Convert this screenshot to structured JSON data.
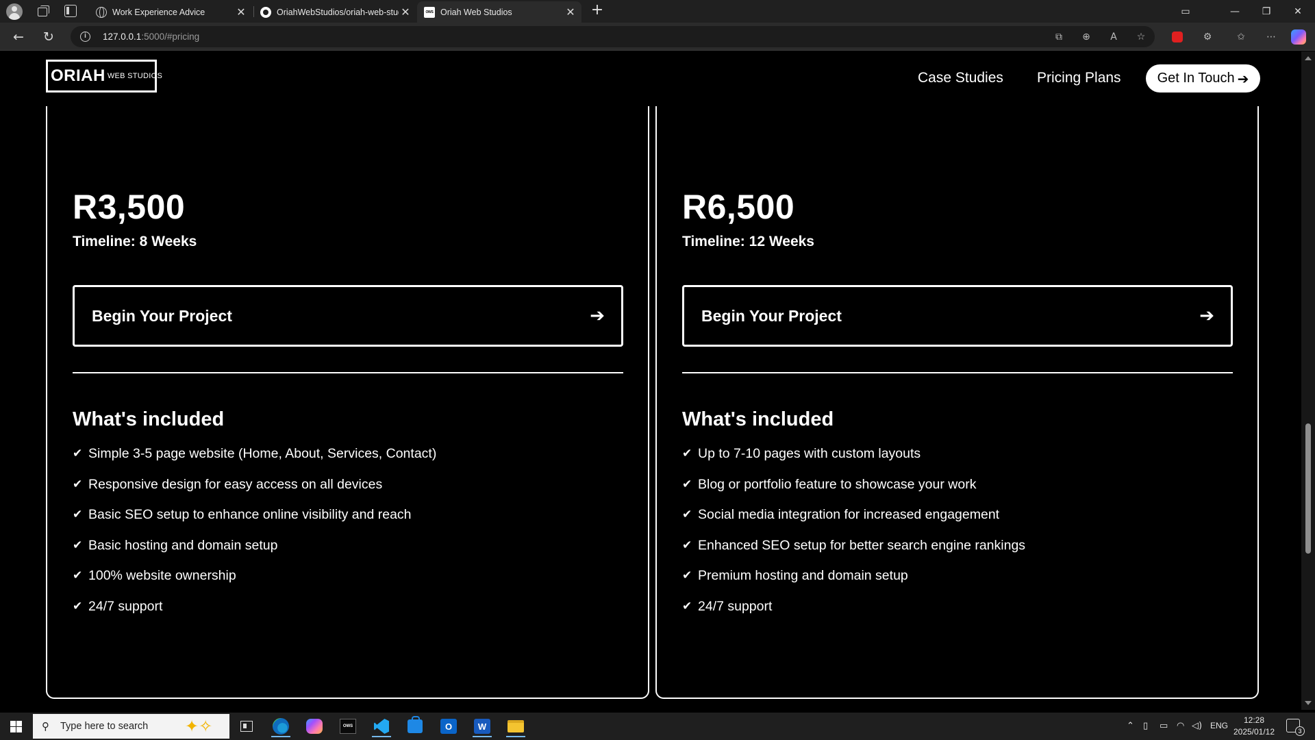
{
  "browser": {
    "tabs": [
      {
        "title": "Work Experience Advice",
        "favicon": "globe-icon",
        "active": false
      },
      {
        "title": "OriahWebStudios/oriah-web-stud",
        "favicon": "github-icon",
        "active": false
      },
      {
        "title": "Oriah Web Studios",
        "favicon": "ows-logo-icon",
        "active": true
      }
    ],
    "address": {
      "host": "127.0.0.1",
      "rest": ":5000/#pricing"
    }
  },
  "site": {
    "logo": {
      "big": "ORIAH",
      "small": "WEB STUDIOS"
    },
    "nav": {
      "case_studies": "Case Studies",
      "pricing_plans": "Pricing Plans",
      "cta": "Get In Touch"
    }
  },
  "plans": [
    {
      "price": "R3,500",
      "timeline": "Timeline: 8 Weeks",
      "button": "Begin Your Project",
      "included_title": "What's included",
      "features": [
        "Simple 3-5 page website (Home, About, Services, Contact)",
        "Responsive design for easy access on all devices",
        "Basic SEO setup to enhance online visibility and reach",
        "Basic hosting and domain setup",
        "100% website ownership",
        "24/7 support"
      ]
    },
    {
      "price": "R6,500",
      "timeline": "Timeline: 12 Weeks",
      "button": "Begin Your Project",
      "included_title": "What's included",
      "features": [
        "Up to 7-10 pages with custom layouts",
        "Blog or portfolio feature to showcase your work",
        "Social media integration for increased engagement",
        "Enhanced SEO setup for better search engine rankings",
        "Premium hosting and domain setup",
        "24/7 support"
      ]
    }
  ],
  "taskbar": {
    "search_placeholder": "Type here to search",
    "language": "ENG",
    "time": "12:28",
    "date": "2025/01/12",
    "notifications": "3",
    "ows_app_label": "OWS",
    "outlook_label": "O",
    "word_label": "W"
  },
  "colors": {
    "page_bg": "#000000",
    "text": "#ffffff",
    "chrome_bg": "#202020",
    "accent": "#76b9ed"
  }
}
